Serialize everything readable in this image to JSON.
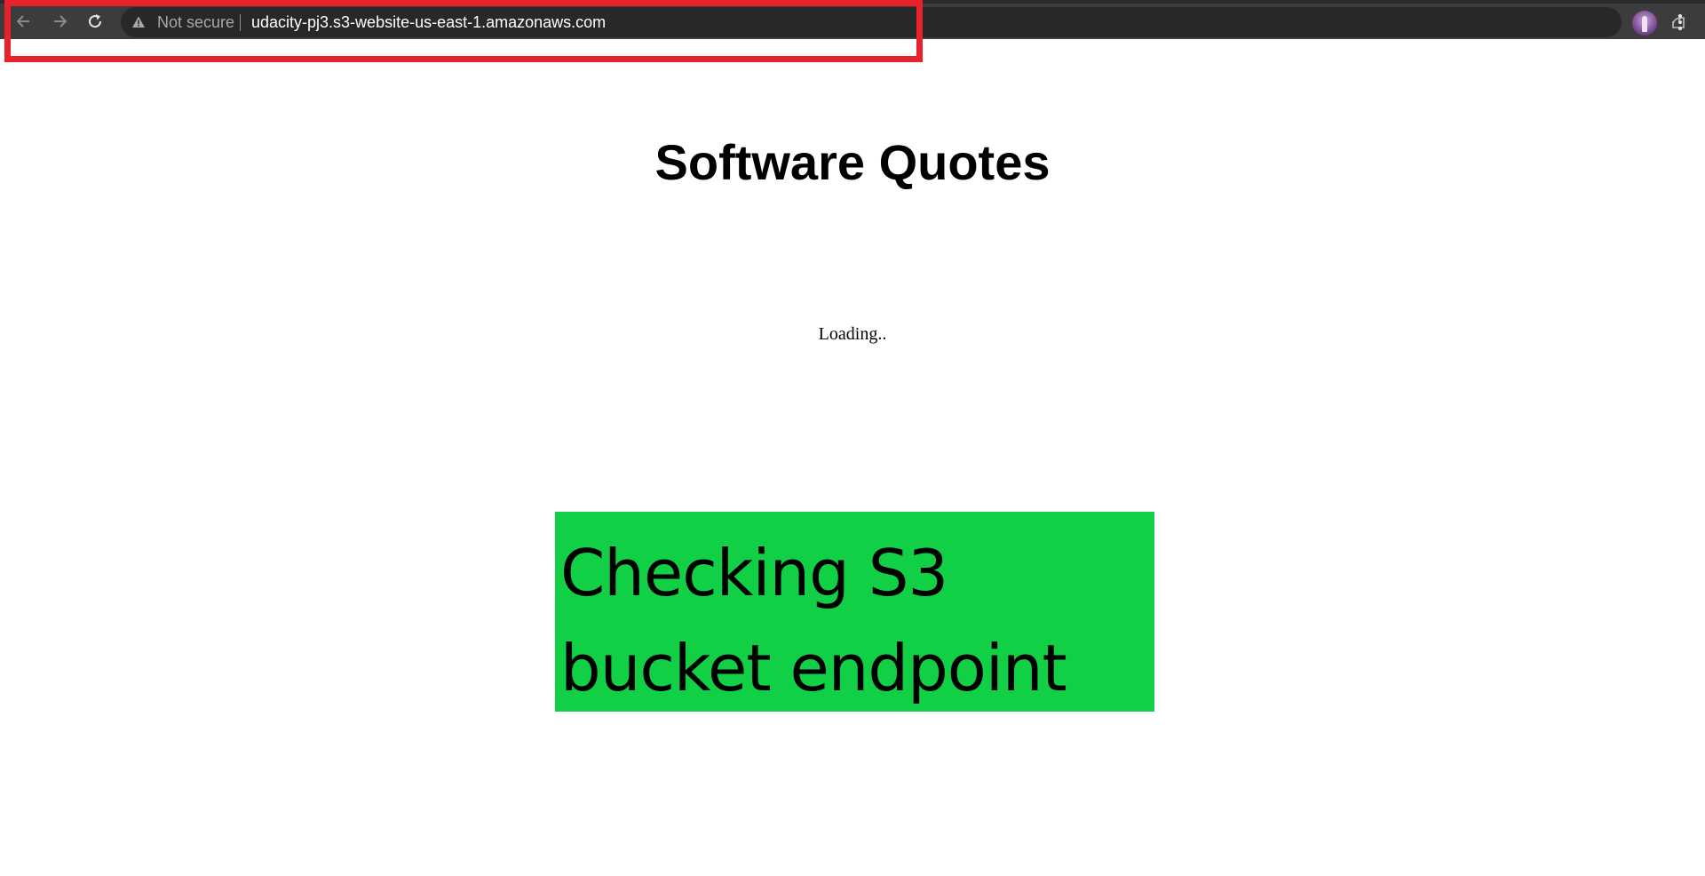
{
  "browser": {
    "security_label": "Not secure",
    "url": "udacity-pj3.s3-website-us-east-1.amazonaws.com",
    "icons": {
      "back": "arrow-left-icon",
      "forward": "arrow-right-icon",
      "reload": "reload-icon",
      "warning": "warning-triangle-icon",
      "share": "share-icon",
      "bookmark": "star-icon",
      "profile": "avatar",
      "menu": "kebab-menu-icon"
    }
  },
  "page": {
    "title": "Software Quotes",
    "loading_text": "Loading..",
    "banner": {
      "line1": "Checking S3",
      "line2": "bucket endpoint"
    }
  },
  "colors": {
    "toolbar": "#3c3c3c",
    "omnibox": "#282828",
    "highlight": "#e8212a",
    "banner_bg": "#11d046"
  }
}
